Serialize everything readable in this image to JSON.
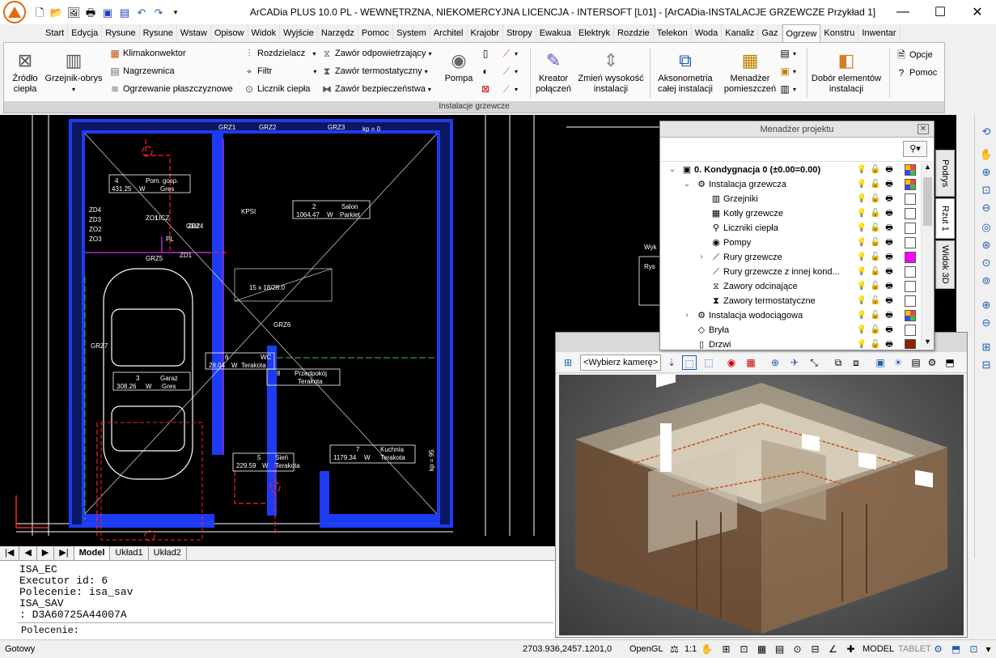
{
  "title_bar": {
    "title": "ArCADia PLUS 10.0 PL - WEWNĘTRZNA, NIEKOMERCYJNA LICENCJA - INTERSOFT [L01] - [ArCADia-INSTALACJE GRZEWCZE Przykład 1]",
    "qat_icons": [
      "new-icon",
      "open-icon",
      "photo-icon",
      "print-icon",
      "save-icon",
      "save-as-icon",
      "undo-icon",
      "redo-icon",
      "customize-icon"
    ]
  },
  "tabs": [
    "Start",
    "Edycja",
    "Rysune",
    "Rysune",
    "Wstaw",
    "Opisow",
    "Widok",
    "Wyjście",
    "Narzędz",
    "Pomoc",
    "System",
    "Architel",
    "Krajobr",
    "Stropy",
    "Ewakua",
    "Elektryk",
    "Rozdzie",
    "Telekon",
    "Woda",
    "Kanaliz",
    "Gaz",
    "Ogrzew",
    "Konstru",
    "Inwentar"
  ],
  "active_tab": "Ogrzew",
  "ribbon": {
    "zrodlo": "Źródło\nciepła",
    "grzejnik": "Grzejnik-obrys",
    "klimakonwektor": "Klimakonwektor",
    "nagrzewnica": "Nagrzewnica",
    "ogrzewanie": "Ogrzewanie płaszczyznowe",
    "rozdzielacz": "Rozdzielacz",
    "filtr": "Filtr",
    "licznik": "Licznik ciepła",
    "zawor_odp": "Zawór odpowietrzający",
    "zawor_termo": "Zawór termostatyczny",
    "zawor_bezp": "Zawór bezpieczeństwa",
    "pompa": "Pompa",
    "kreator": "Kreator\npołączeń",
    "zmien": "Zmień wysokość\ninstalacji",
    "akso": "Aksonometria\ncałej instalacji",
    "menadzer": "Menadżer\npomieszczeń",
    "dobor": "Dobór elementów\ninstalacji",
    "opcje": "Opcje",
    "pomoc": "Pomoc",
    "group_label": "Instalacje grzewcze"
  },
  "drawing": {
    "rooms": [
      {
        "num": "4",
        "name": "Pom. gosp.",
        "area": "431.25",
        "unit": "W",
        "floor": "Gres"
      },
      {
        "num": "2",
        "name": "Salon",
        "area": "1064.47",
        "unit": "W",
        "floor": "Parkiet"
      },
      {
        "num": "3",
        "name": "Garaż",
        "area": "308.26",
        "unit": "W",
        "floor": "Gres"
      },
      {
        "num": "6",
        "name": "WC",
        "area": "28.04",
        "unit": "W",
        "floor": "Terakota"
      },
      {
        "num": "8",
        "name": "Przedpokój",
        "area": "",
        "unit": "",
        "floor": "Terakota"
      },
      {
        "num": "5",
        "name": "Sień",
        "area": "229.59",
        "unit": "W",
        "floor": "Terakota"
      },
      {
        "num": "7",
        "name": "Kuchnia",
        "area": "1179.34",
        "unit": "W",
        "floor": "Terakota"
      }
    ],
    "labels": [
      "GRZ1",
      "GRZ2",
      "GRZ3",
      "GRZ4",
      "GRZ5",
      "GRZ6",
      "GRZ7",
      "ZD1",
      "ZD2",
      "ZD3",
      "ZD4",
      "ZO1",
      "ZO2",
      "ZO3",
      "LICZ",
      "PL",
      "KPSI",
      "15 x 18/28.0",
      "kp = 0",
      "kp = 95",
      "Wyk",
      "Rys"
    ]
  },
  "layout_tabs": [
    "Model",
    "Układ1",
    "Układ2"
  ],
  "command_lines": [
    "ISA_EC",
    "Executor id: 6",
    "Polecenie: isa_sav",
    "ISA_SAV",
    ": D3A60725A44007A"
  ],
  "command_prompt": "Polecenie:",
  "status": {
    "ready": "Gotowy",
    "coords": "2703.936,2457.1201,0",
    "renderer": "OpenGL",
    "scale": "1:1",
    "model": "MODEL",
    "tablet": "TABLET"
  },
  "side_tabs": [
    "Podrys",
    "Rzut 1",
    "Widok 3D"
  ],
  "project_manager": {
    "title": "Menadżer projektu",
    "tree": [
      {
        "label": "0. Kondygnacja 0 (±0.00=0.00)",
        "level": 0,
        "expanded": true,
        "bold": true,
        "color": "multi"
      },
      {
        "label": "Instalacja grzewcza",
        "level": 1,
        "expanded": true,
        "color": "multi"
      },
      {
        "label": "Grzejniki",
        "level": 2,
        "color": "#ffffff"
      },
      {
        "label": "Kotły grzewcze",
        "level": 2,
        "color": "#ffffff"
      },
      {
        "label": "Liczniki ciepła",
        "level": 2,
        "color": "#ffffff"
      },
      {
        "label": "Pompy",
        "level": 2,
        "color": "#ffffff"
      },
      {
        "label": "Rury grzewcze",
        "level": 2,
        "collapsed": true,
        "color": "#ff00ff"
      },
      {
        "label": "Rury grzewcze z innej kond...",
        "level": 2,
        "color": "#ffffff"
      },
      {
        "label": "Zawory odcinające",
        "level": 2,
        "color": "#ffffff"
      },
      {
        "label": "Zawory termostatyczne",
        "level": 2,
        "color": "#ffffff"
      },
      {
        "label": "Instalacja wodociągowa",
        "level": 1,
        "collapsed": true,
        "color": "multi"
      },
      {
        "label": "Bryła",
        "level": 1,
        "color": "#ffffff"
      },
      {
        "label": "Drzwi",
        "level": 1,
        "color": "#8b2500"
      }
    ]
  },
  "view3d": {
    "camera_placeholder": "<Wybierz kamerę>"
  },
  "colors": {
    "wall_blue": "#1f3fff",
    "pipe_red": "#ff2020",
    "pipe_magenta": "#cc33ff",
    "accent_orange": "#e06a10"
  }
}
